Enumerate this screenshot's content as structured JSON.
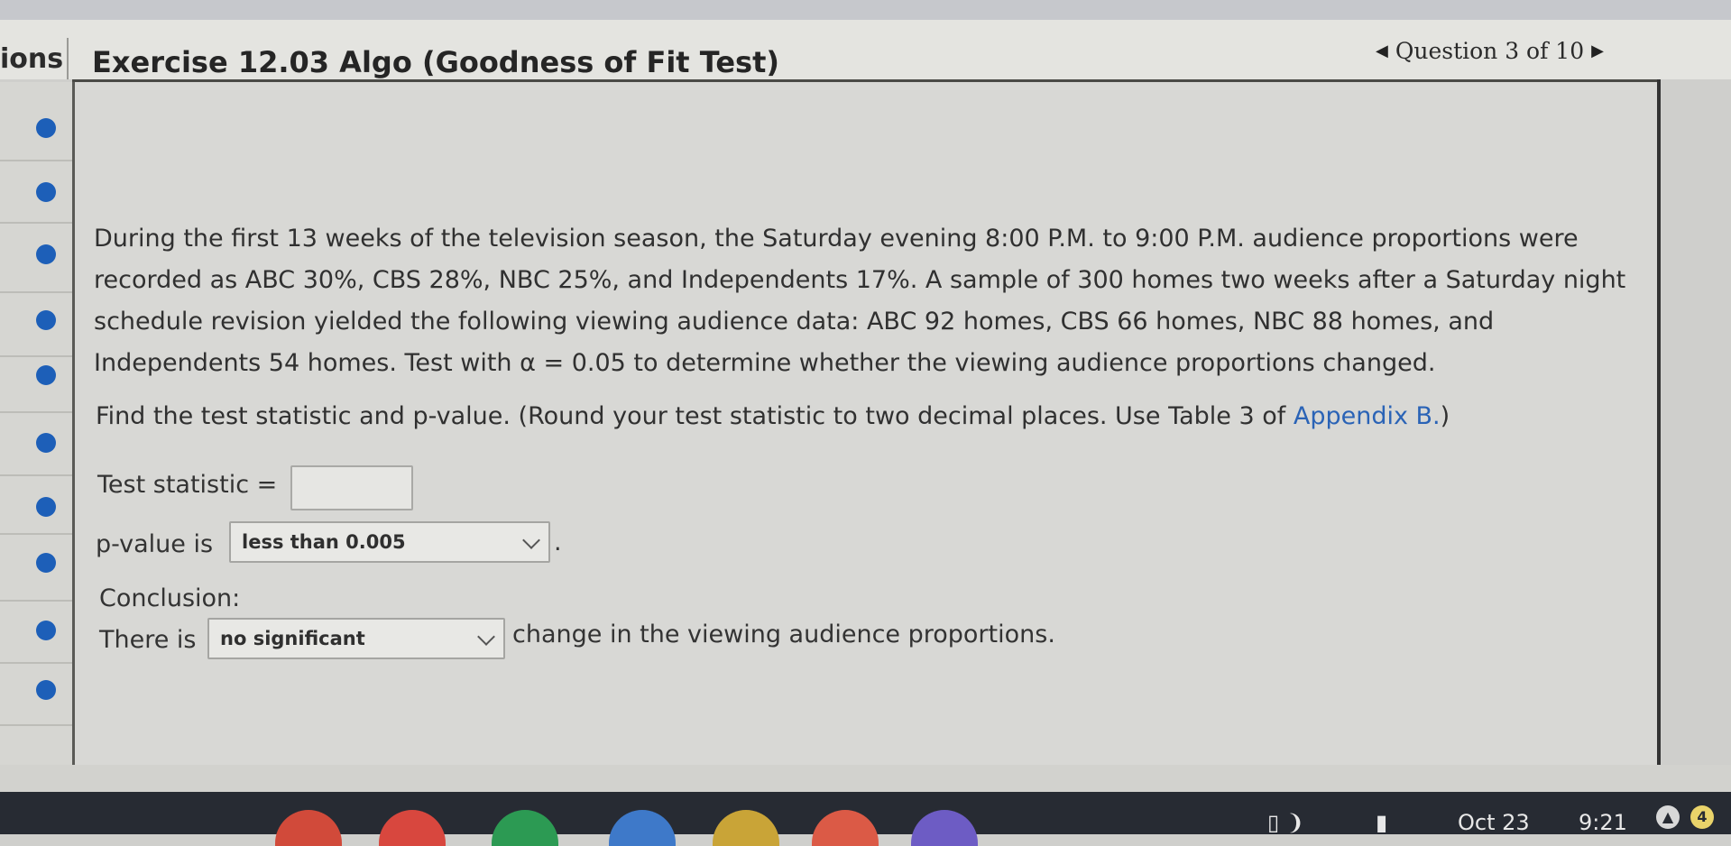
{
  "header": {
    "section_label": "ions",
    "exercise_title": "Exercise 12.03 Algo (Goodness of Fit Test)",
    "question_nav": "Question 3 of 10",
    "prev_icon": "triangle-left-icon",
    "next_icon": "triangle-right-icon"
  },
  "problem": {
    "line1": "During the first 13 weeks of the television season, the Saturday evening 8:00 P.M. to 9:00 P.M. audience proportions were",
    "line2": "recorded as ABC 30%, CBS 28%, NBC 25%, and Independents 17%. A sample of 300 homes two weeks after a Saturday night",
    "line3": "schedule revision yielded the following viewing audience data: ABC 92 homes, CBS 66 homes, NBC 88 homes, and",
    "line4": "Independents 54 homes. Test with α = 0.05 to determine whether the viewing audience proportions changed."
  },
  "instruction": {
    "text": "Find the test statistic and p-value. (Round your test statistic to two decimal places. Use Table 3 of ",
    "link": "Appendix B.",
    "suffix": ")"
  },
  "test_statistic": {
    "label": "Test statistic =",
    "value": ""
  },
  "p_value": {
    "label": "p-value is",
    "selected": "less than 0.005",
    "suffix": "."
  },
  "conclusion": {
    "label": "Conclusion:",
    "prefix": "There is",
    "selected": "no significant",
    "suffix": "change in the viewing audience proportions."
  },
  "taskbar": {
    "date": "Oct 23",
    "time": "9:21",
    "notification_count": "4"
  },
  "colors": {
    "accent_blue": "#1d5fb8",
    "link_blue": "#2a63b6"
  }
}
